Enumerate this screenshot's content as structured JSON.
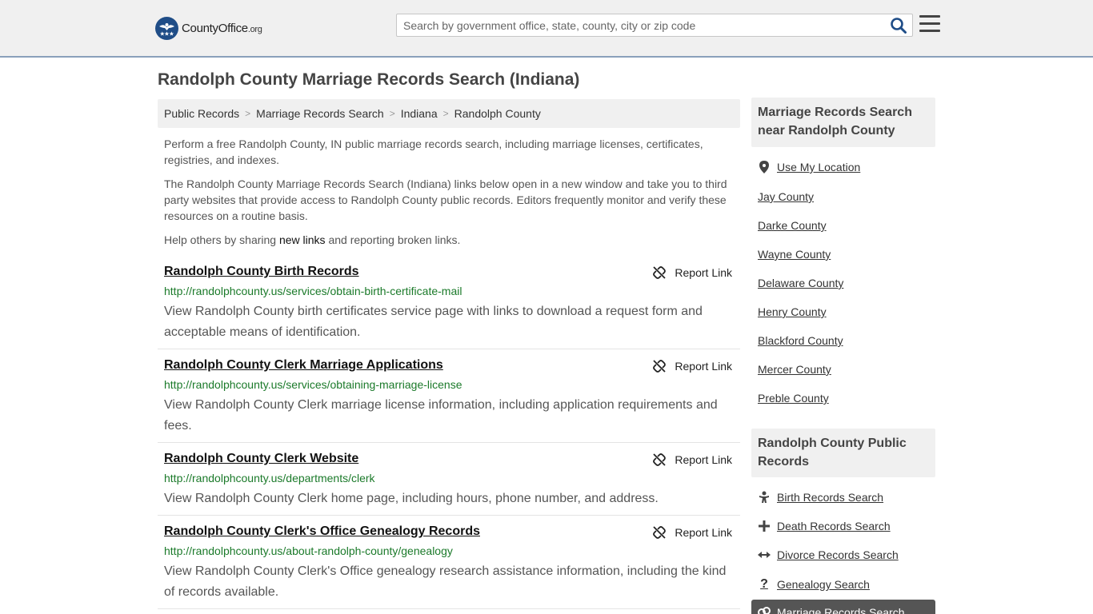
{
  "header": {
    "logo_name": "County",
    "logo_office": "Office",
    "logo_tld": ".org",
    "search_placeholder": "Search by government office, state, county, city or zip code"
  },
  "page_title": "Randolph County Marriage Records Search (Indiana)",
  "breadcrumb": [
    "Public Records",
    "Marriage Records Search",
    "Indiana",
    "Randolph County"
  ],
  "intro": {
    "p1": "Perform a free Randolph County, IN public marriage records search, including marriage licenses, certificates, registries, and indexes.",
    "p2": "The Randolph County Marriage Records Search (Indiana) links below open in a new window and take you to third party websites that provide access to Randolph County public records. Editors frequently monitor and verify these resources on a routine basis.",
    "p3_before": "Help others by sharing ",
    "p3_link": "new links",
    "p3_after": " and reporting broken links."
  },
  "report_label": "Report Link",
  "results": [
    {
      "title": "Randolph County Birth Records",
      "url": "http://randolphcounty.us/services/obtain-birth-certificate-mail",
      "desc": "View Randolph County birth certificates service page with links to download a request form and acceptable means of identification."
    },
    {
      "title": "Randolph County Clerk Marriage Applications",
      "url": "http://randolphcounty.us/services/obtaining-marriage-license",
      "desc": "View Randolph County Clerk marriage license information, including application requirements and fees."
    },
    {
      "title": "Randolph County Clerk Website",
      "url": "http://randolphcounty.us/departments/clerk",
      "desc": "View Randolph County Clerk home page, including hours, phone number, and address."
    },
    {
      "title": "Randolph County Clerk's Office Genealogy Records",
      "url": "http://randolphcounty.us/about-randolph-county/genealogy",
      "desc": "View Randolph County Clerk's Office genealogy research assistance information, including the kind of records available."
    }
  ],
  "sidebar": {
    "nearby_title": "Marriage Records Search near Randolph County",
    "use_location": "Use My Location",
    "nearby": [
      "Jay County",
      "Darke County",
      "Wayne County",
      "Delaware County",
      "Henry County",
      "Blackford County",
      "Mercer County",
      "Preble County"
    ],
    "public_title": "Randolph County Public Records",
    "public_links": [
      {
        "label": "Birth Records Search",
        "icon": "baby-icon"
      },
      {
        "label": "Death Records Search",
        "icon": "cross-icon"
      },
      {
        "label": "Divorce Records Search",
        "icon": "arrows-split-icon"
      },
      {
        "label": "Genealogy Search",
        "icon": "question-icon"
      }
    ],
    "active_link": {
      "label": "Marriage Records Search",
      "icon": "rings-icon"
    }
  },
  "colors": {
    "brand": "#1f4d87",
    "url_green": "#1b7a2a",
    "panel_bg": "#f0f0f0",
    "active_bg": "#555555"
  }
}
